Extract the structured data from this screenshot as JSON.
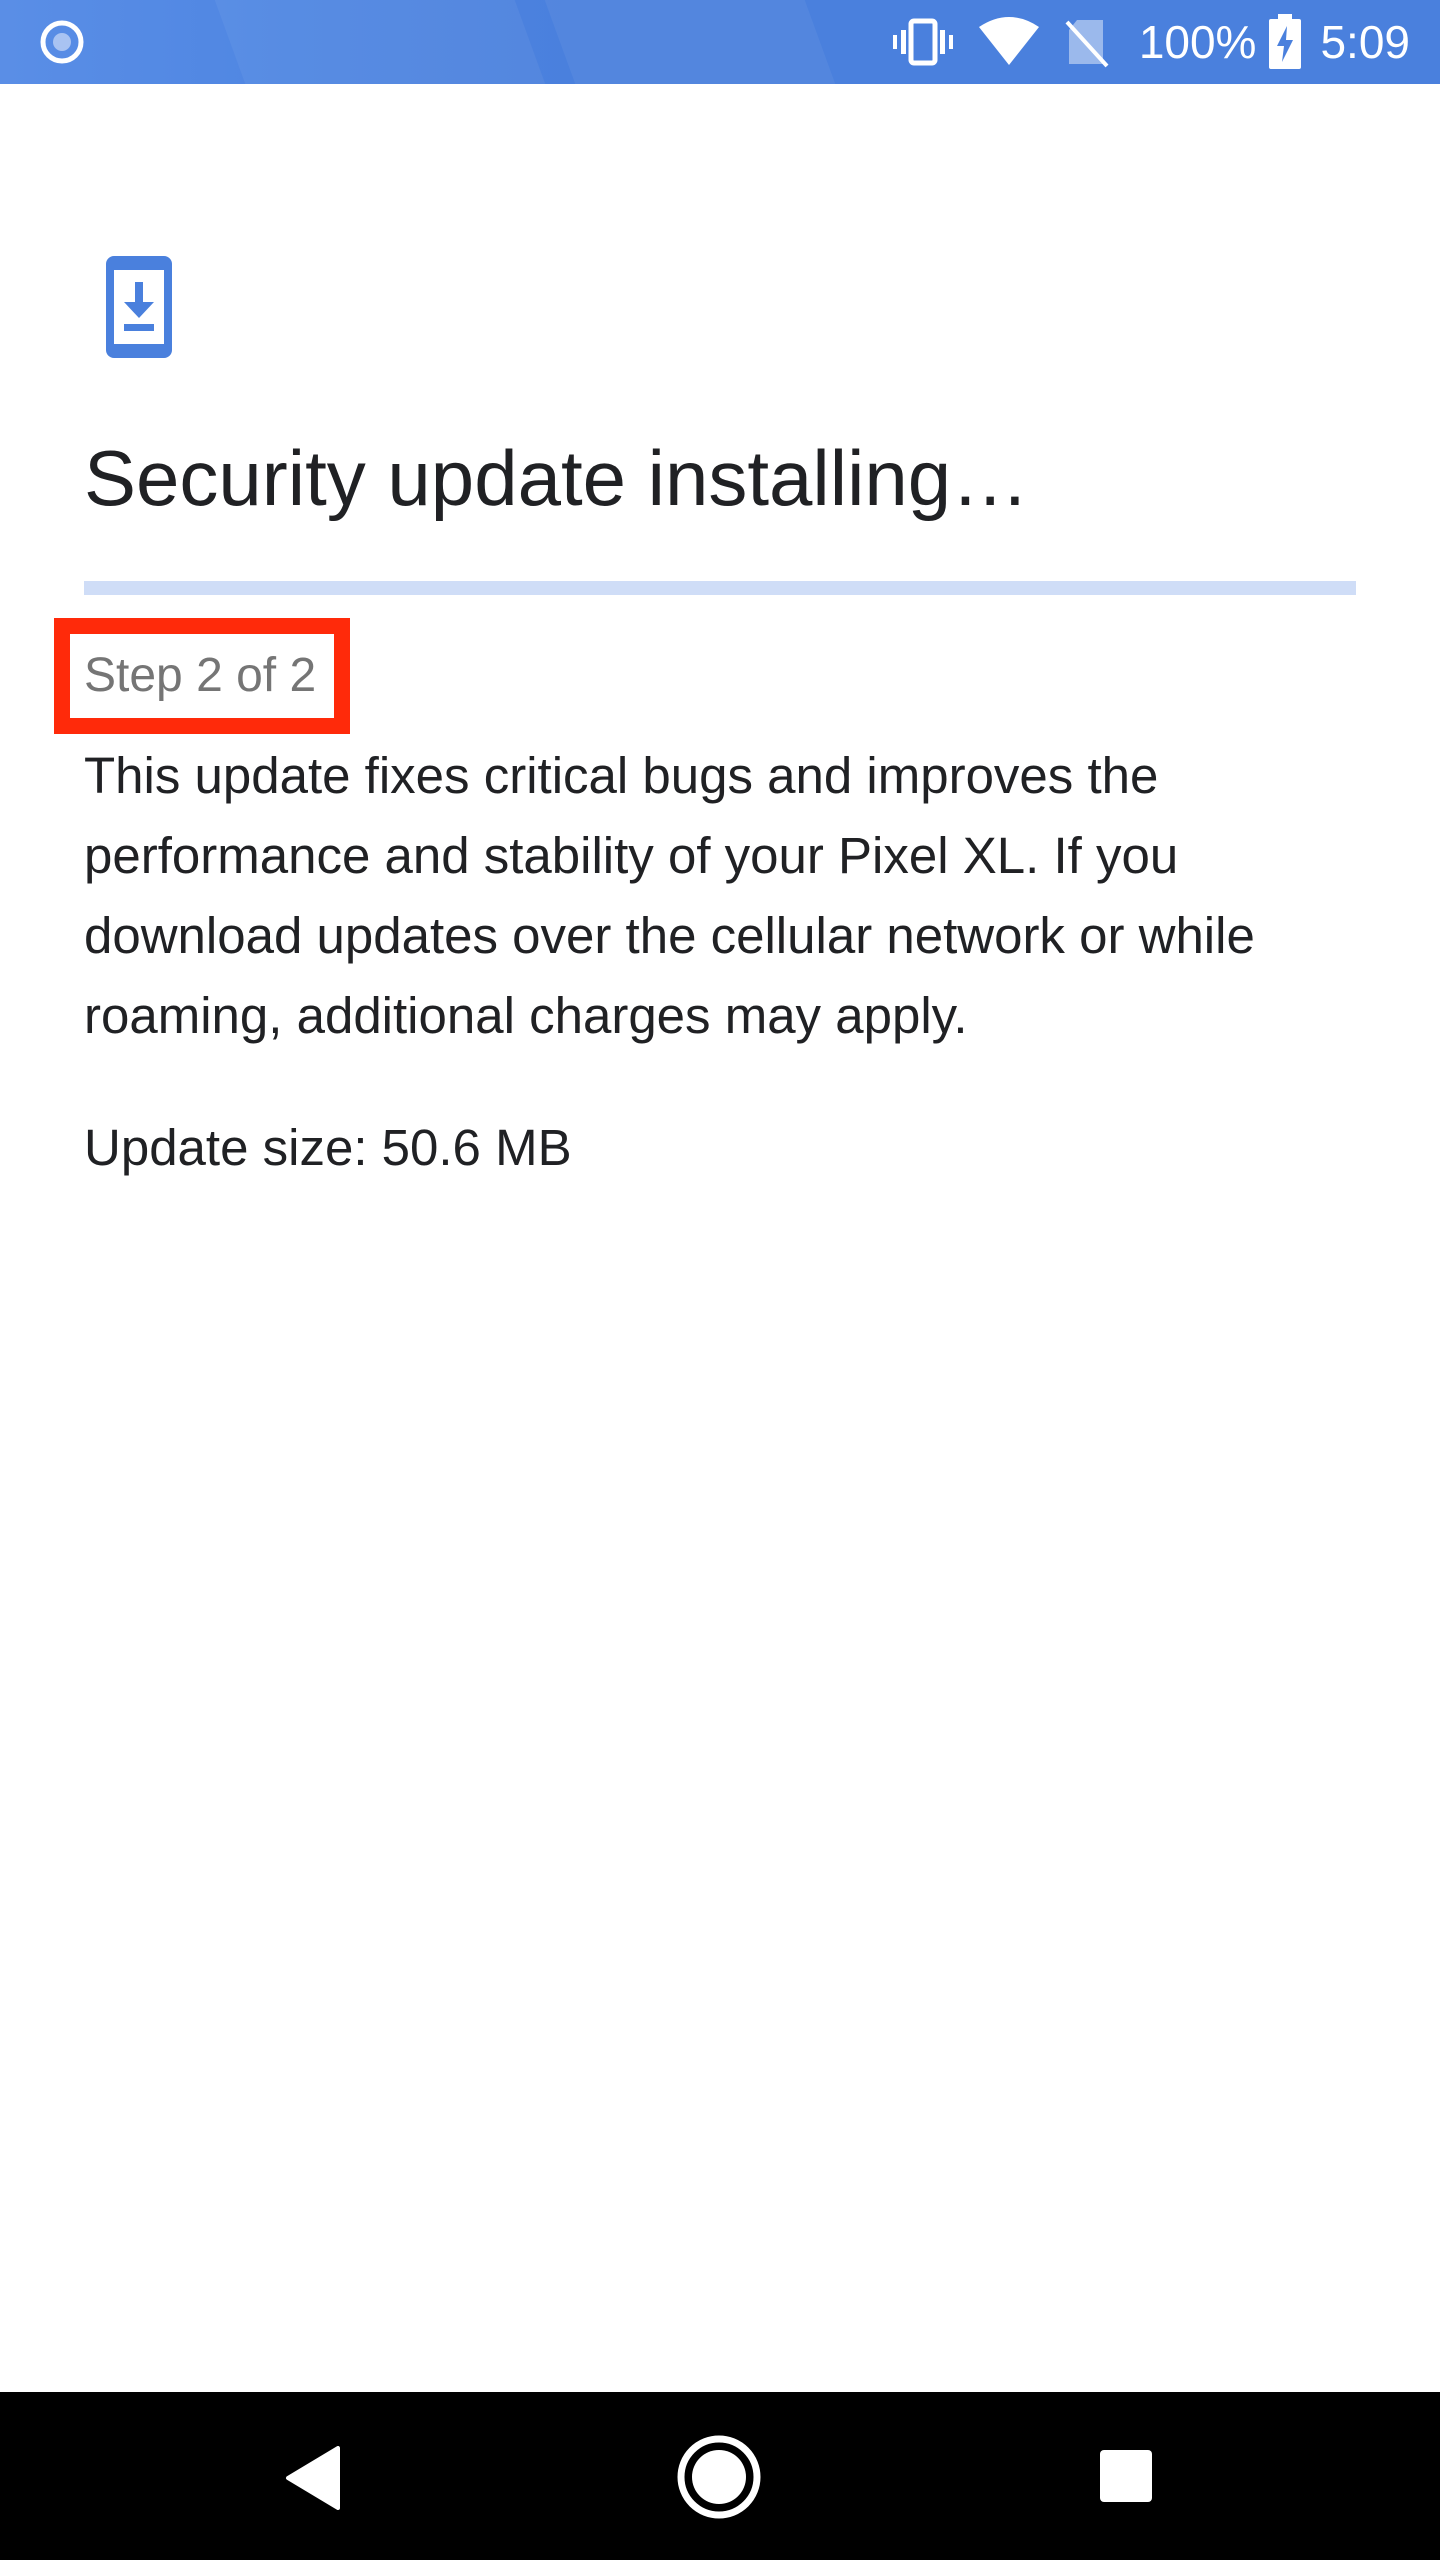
{
  "status_bar": {
    "notification_icon": "assistant-circle-icon",
    "icons": [
      "vibrate-icon",
      "wifi-icon",
      "no-sim-icon",
      "battery-charging-icon"
    ],
    "battery_percent": "100%",
    "time": "5:09",
    "color": "#4a80dd"
  },
  "header": {
    "icon": "system-update-download-icon",
    "title": "Security update installing…"
  },
  "progress": {
    "value": 0,
    "track_color": "#cfddf7",
    "fill_color": "#4a80dd"
  },
  "step": {
    "label": "Step 2 of 2",
    "highlight_color": "#ff2a0a"
  },
  "description": "This update fixes critical bugs and improves the performance and stability of your Pixel XL. If you download updates over the cellular network or while roaming, additional charges may apply.",
  "update_size": "Update size: 50.6 MB",
  "nav_bar": {
    "buttons": [
      "back-icon",
      "home-icon",
      "recents-icon"
    ]
  }
}
